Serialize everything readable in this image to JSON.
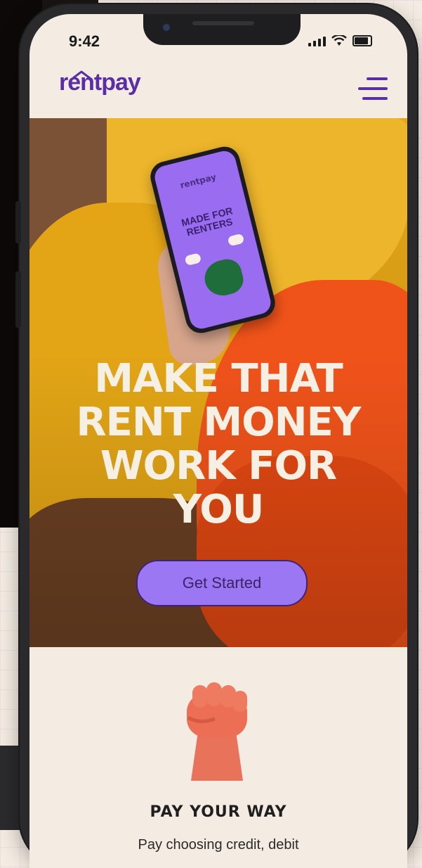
{
  "status_bar": {
    "time": "9:42"
  },
  "header": {
    "logo_text": "rentpay",
    "menu_icon": "hamburger-menu-icon"
  },
  "hero": {
    "headline": "MAKE THAT RENT MONEY WORK FOR YOU",
    "cta_label": "Get Started",
    "mini_phone": {
      "logo_text": "rentpay",
      "title": "MADE FOR RENTERS"
    }
  },
  "feature": {
    "icon": "raised-fist-icon",
    "title": "PAY YOUR WAY",
    "description": "Pay choosing credit, debit"
  },
  "colors": {
    "brand_purple": "#5a2ea6",
    "cta_fill": "#9c77f3",
    "background": "#f4ece2",
    "accent_orange": "#f0531a"
  }
}
